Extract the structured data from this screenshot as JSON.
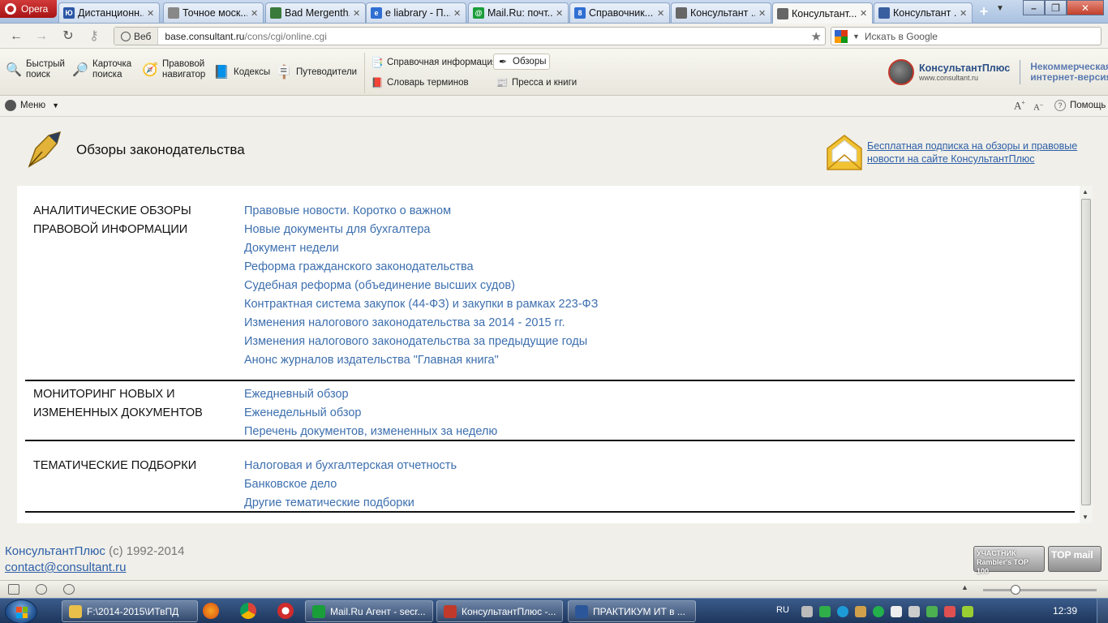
{
  "browser": {
    "menu_label": "Opera",
    "tabs": [
      {
        "label": "Дистанционн...",
        "color": "#2b57a6",
        "glyph": "Ю"
      },
      {
        "label": "Точное моск...",
        "color": "#888888",
        "glyph": ""
      },
      {
        "label": "Bad Mergenth...",
        "color": "#3a7a3a",
        "glyph": ""
      },
      {
        "label": "e liabrary - П...",
        "color": "#2f6fd2",
        "glyph": "e"
      },
      {
        "label": "Mail.Ru: почт...",
        "color": "#1a9e3a",
        "glyph": "@"
      },
      {
        "label": "Справочник...",
        "color": "#2f6fd2",
        "glyph": "8"
      },
      {
        "label": "Консультант ...",
        "color": "#666666",
        "glyph": ""
      },
      {
        "label": "Консультант...",
        "color": "#666666",
        "glyph": ""
      },
      {
        "label": "Консультант ...",
        "color": "#3a5fa0",
        "glyph": ""
      }
    ],
    "active_tab_index": 7,
    "new_tab": "+",
    "address": {
      "badge": "Веб",
      "domain": "base.consultant.ru",
      "path": "/cons/cgi/online.cgi"
    },
    "search_placeholder": "Искать в Google"
  },
  "toolbar": {
    "quick_search": "Быстрый поиск",
    "search_card": "Карточка поиска",
    "legal_navigator": "Правовой навигатор",
    "codes": "Кодексы",
    "guides": "Путеводители",
    "reference_info": "Справочная информация",
    "reviews": "Обзоры",
    "dictionary": "Словарь терминов",
    "press": "Пресса и книги",
    "brand_name": "КонсультантПлюс",
    "brand_url": "www.consultant.ru",
    "brand_version": "Некоммерческая интернет-версия"
  },
  "menubar": {
    "menu": "Меню",
    "help": "Помощь"
  },
  "page": {
    "title": "Обзоры законодательства",
    "promo_link": "Бесплатная подписка на обзоры и правовые новости на сайте КонсультантПлюс",
    "sections": [
      {
        "title": "АНАЛИТИЧЕСКИЕ ОБЗОРЫ ПРАВОВОЙ ИНФОРМАЦИИ",
        "links": [
          "Правовые новости. Коротко о важном",
          "Новые документы для бухгалтера",
          "Документ недели",
          "Реформа гражданского законодательства",
          "Судебная реформа (объединение высших судов)",
          "Контрактная система закупок (44-ФЗ) и закупки в рамках 223-ФЗ",
          "Изменения налогового законодательства за 2014 - 2015 гг.",
          "Изменения налогового законодательства за предыдущие годы",
          "Анонс журналов издательства \"Главная книга\""
        ]
      },
      {
        "title": "МОНИТОРИНГ НОВЫХ И ИЗМЕНЕННЫХ ДОКУМЕНТОВ",
        "links": [
          "Ежедневный обзор",
          "Еженедельный обзор",
          "Перечень документов, измененных за неделю"
        ]
      },
      {
        "title": "ТЕМАТИЧЕСКИЕ ПОДБОРКИ",
        "links": [
          "Налоговая и бухгалтерская отчетность",
          "Банковское дело",
          "Другие тематические подборки"
        ]
      }
    ],
    "copyright_brand": "КонсультантПлюс",
    "copyright_years": " (c) 1992-2014",
    "contact": "contact@consultant.ru",
    "rambler_badge": "УЧАСТНИК Rambler's TOP 100",
    "topmail_badge": "TOP mail"
  },
  "taskbar": {
    "tasks": [
      {
        "label": "F:\\2014-2015\\ИТвПД",
        "color": "#e8c04a"
      },
      {
        "label": "Mail.Ru Агент - secr...",
        "color": "#1a9e3a"
      },
      {
        "label": "КонсультантПлюс -...",
        "color": "#c0392b"
      },
      {
        "label": "ПРАКТИКУМ ИТ в ...",
        "color": "#2b579a"
      }
    ],
    "lang": "RU",
    "time": "12:39"
  }
}
